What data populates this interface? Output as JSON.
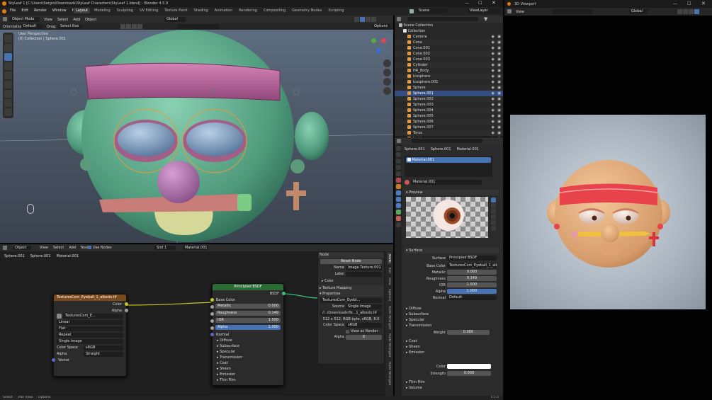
{
  "title": "StyLeaf 1 [C:\\Users\\Sergio\\Downloads\\StyLeaf Characters\\StyLeaf 1.blend] - Blender 4.5.0",
  "menu": [
    "File",
    "Edit",
    "Render",
    "Window",
    "Help"
  ],
  "workspaces": [
    "Layout",
    "Modeling",
    "Sculpting",
    "UV Editing",
    "Texture Paint",
    "Shading",
    "Animation",
    "Rendering",
    "Compositing",
    "Geometry Nodes",
    "Scripting"
  ],
  "viewport": {
    "mode": "Object Mode",
    "menus": [
      "View",
      "Select",
      "Add",
      "Object"
    ],
    "transform": "Global",
    "orientation_label": "Orientation:",
    "orientation": "Default",
    "drag_label": "Drag:",
    "drag": "Select Box",
    "options": "Options",
    "info1": "User Perspective",
    "info2": "(0) Collection | Sphere.001"
  },
  "outliner": {
    "header": "Scene",
    "view_layer": "ViewLayer",
    "root": "Scene Collection",
    "collection": "Collection",
    "items": [
      {
        "name": "Camera",
        "color": "#e69a3a"
      },
      {
        "name": "Cone",
        "color": "#e69a3a"
      },
      {
        "name": "Cone.001",
        "color": "#e69a3a"
      },
      {
        "name": "Cone.002",
        "color": "#e69a3a"
      },
      {
        "name": "Cone.003",
        "color": "#e69a3a"
      },
      {
        "name": "Cylinder",
        "color": "#e69a3a"
      },
      {
        "name": "HR_Body",
        "color": "#e69a3a"
      },
      {
        "name": "Icosphere",
        "color": "#e69a3a"
      },
      {
        "name": "Icosphere.001",
        "color": "#e69a3a"
      },
      {
        "name": "Sphere",
        "color": "#e69a3a"
      },
      {
        "name": "Sphere.001",
        "color": "#e69a3a",
        "selected": true
      },
      {
        "name": "Sphere.002",
        "color": "#e69a3a"
      },
      {
        "name": "Sphere.003",
        "color": "#e69a3a"
      },
      {
        "name": "Sphere.004",
        "color": "#e69a3a"
      },
      {
        "name": "Sphere.005",
        "color": "#e69a3a"
      },
      {
        "name": "Sphere.006",
        "color": "#e69a3a"
      },
      {
        "name": "Sphere.007",
        "color": "#e69a3a"
      },
      {
        "name": "Torus",
        "color": "#e69a3a"
      },
      {
        "name": "Light",
        "color": "#e69a3a"
      }
    ]
  },
  "properties": {
    "breadcrumb": [
      "Sphere.001",
      "Sphere.001",
      "Material.001"
    ],
    "slot": "Material.001",
    "material": "Material.001",
    "preview": "Preview",
    "surface_section": "Surface",
    "surface_label": "Surface",
    "surface_value": "Principled BSDF",
    "rows": [
      {
        "label": "Base Color",
        "value": "TexturesCom_Eyeball_1_albedo"
      },
      {
        "label": "Metallic",
        "value": "0.000"
      },
      {
        "label": "Roughness",
        "value": "0.149"
      },
      {
        "label": "IOR",
        "value": "1.500"
      },
      {
        "label": "Alpha",
        "value": "1.000"
      },
      {
        "label": "Normal",
        "value": "Default"
      }
    ],
    "sections": [
      "Diffuse",
      "Subsurface",
      "Specular",
      "Transmission"
    ],
    "weight_label": "Weight",
    "weight_value": "0.000",
    "sections2": [
      "Coat",
      "Sheen",
      "Emission"
    ],
    "emission_color_label": "Color",
    "strength_label": "Strength",
    "strength_value": "0.000",
    "sections3": [
      "Thin Film",
      "Volume"
    ]
  },
  "node_editor": {
    "mode": "Object",
    "menus": [
      "View",
      "Select",
      "Add",
      "Node"
    ],
    "use_nodes": "Use Nodes",
    "slot": "Slot 1",
    "material": "Material.001",
    "breadcrumb": [
      "Sphere.001",
      "Sphere.001",
      "Material.001"
    ],
    "tex_node": {
      "title": "TexturesCom_Eyeball_1_albedo.tif",
      "out_color": "Color",
      "out_alpha": "Alpha",
      "image": "TexturesCom_E...",
      "interp": "Linear",
      "proj": "Flat",
      "ext": "Repeat",
      "source": "Single Image",
      "cs_label": "Color Space",
      "cs_value": "sRGB",
      "alpha_label": "Alpha",
      "alpha_value": "Straight",
      "vector": "Vector"
    },
    "bsdf_node": {
      "title": "Principled BSDF",
      "out": "BSDF",
      "base_color": "Base Color",
      "rows": [
        {
          "label": "Metallic",
          "value": "0.000"
        },
        {
          "label": "Roughness",
          "value": "0.149"
        },
        {
          "label": "IOR",
          "value": "1.500"
        },
        {
          "label": "Alpha",
          "value": "1.000"
        }
      ],
      "normal": "Normal",
      "sections": [
        "Diffuse",
        "Subsurface",
        "Specular",
        "Transmission",
        "Coat",
        "Sheen",
        "Emission",
        "Thin Film"
      ]
    },
    "sidebar": {
      "node_header": "Node",
      "reset": "Reset Node",
      "name_label": "Name",
      "name_value": "Image Texture.001",
      "label_label": "Label",
      "color_label": "Color",
      "texmap": "Texture Mapping",
      "props_header": "Properties",
      "image": "TexturesCom_Eyebl...",
      "source_label": "Source",
      "source_value": "Single Image",
      "filepath": "//..\\Downloads\\Te...1_albedo.tif",
      "info": "512 x 512, RGB byte, sRGB, 8.0",
      "cs_label": "Color Space",
      "cs_value": "sRGB",
      "view_as_render": "View as Render",
      "alpha_label": "Alpha",
      "premult": "0"
    },
    "tabs": [
      "Node",
      "Tool",
      "View",
      "Options",
      "Node Wrangler",
      "Node Wrangler",
      "Node Wrangler"
    ]
  },
  "viewport2": {
    "title": "3D Viewport",
    "view": "View",
    "transform": "Global"
  },
  "statusbar": {
    "items": [
      "Select",
      "Pan View",
      "Options"
    ],
    "version": "4.5.0"
  },
  "colors": {
    "accent": "#4772b3",
    "selected_row": "#334d80",
    "header_bg": "#2a2a2a",
    "panel_bg": "#303030"
  }
}
